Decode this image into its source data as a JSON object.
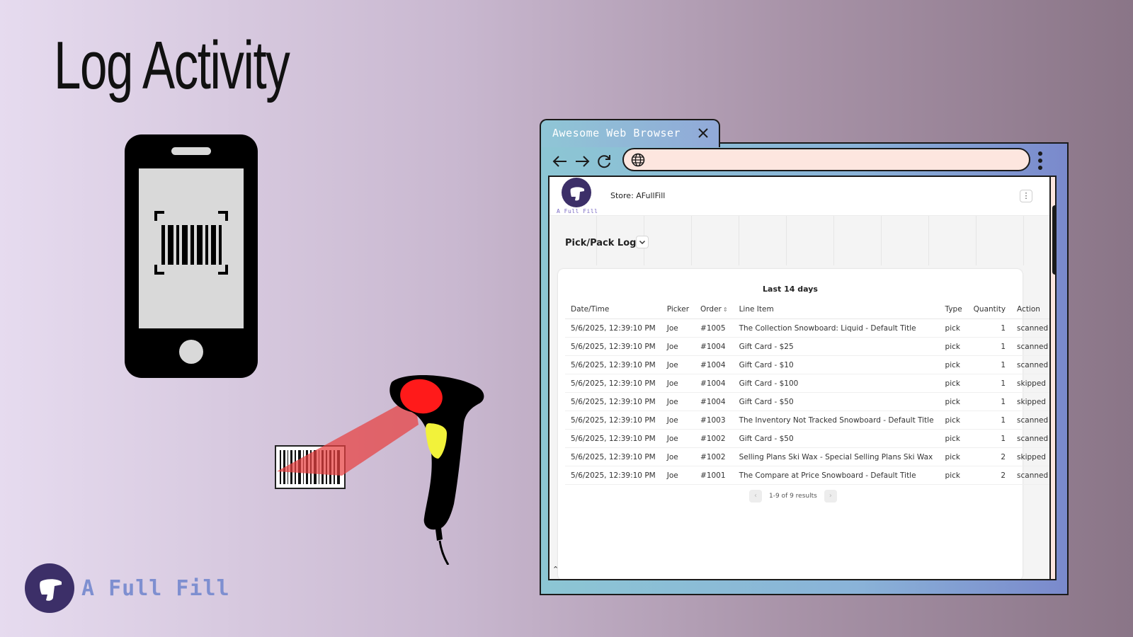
{
  "slide": {
    "headline": "Log Activity",
    "brand_name": "A Full Fill"
  },
  "browser": {
    "tab_title": "Awesome Web Browser",
    "url": ""
  },
  "app": {
    "logo_text": "A Full Fill",
    "store_label": "Store: AFullFill",
    "page_title": "Pick/Pack Logs",
    "card_title": "Last 14 days",
    "columns": [
      "Date/Time",
      "Picker",
      "Order",
      "Line Item",
      "Type",
      "Quantity",
      "Action"
    ],
    "rows": [
      {
        "datetime": "5/6/2025, 12:39:10 PM",
        "picker": "Joe",
        "order": "#1005",
        "line_item": "The Collection Snowboard: Liquid - Default Title",
        "type": "pick",
        "quantity": "1",
        "action": "scanned"
      },
      {
        "datetime": "5/6/2025, 12:39:10 PM",
        "picker": "Joe",
        "order": "#1004",
        "line_item": "Gift Card - $25",
        "type": "pick",
        "quantity": "1",
        "action": "scanned"
      },
      {
        "datetime": "5/6/2025, 12:39:10 PM",
        "picker": "Joe",
        "order": "#1004",
        "line_item": "Gift Card - $10",
        "type": "pick",
        "quantity": "1",
        "action": "scanned"
      },
      {
        "datetime": "5/6/2025, 12:39:10 PM",
        "picker": "Joe",
        "order": "#1004",
        "line_item": "Gift Card - $100",
        "type": "pick",
        "quantity": "1",
        "action": "skipped"
      },
      {
        "datetime": "5/6/2025, 12:39:10 PM",
        "picker": "Joe",
        "order": "#1004",
        "line_item": "Gift Card - $50",
        "type": "pick",
        "quantity": "1",
        "action": "skipped"
      },
      {
        "datetime": "5/6/2025, 12:39:10 PM",
        "picker": "Joe",
        "order": "#1003",
        "line_item": "The Inventory Not Tracked Snowboard - Default Title",
        "type": "pick",
        "quantity": "1",
        "action": "scanned"
      },
      {
        "datetime": "5/6/2025, 12:39:10 PM",
        "picker": "Joe",
        "order": "#1002",
        "line_item": "Gift Card - $50",
        "type": "pick",
        "quantity": "1",
        "action": "scanned"
      },
      {
        "datetime": "5/6/2025, 12:39:10 PM",
        "picker": "Joe",
        "order": "#1002",
        "line_item": "Selling Plans Ski Wax - Special Selling Plans Ski Wax",
        "type": "pick",
        "quantity": "2",
        "action": "skipped"
      },
      {
        "datetime": "5/6/2025, 12:39:10 PM",
        "picker": "Joe",
        "order": "#1001",
        "line_item": "The Compare at Price Snowboard - Default Title",
        "type": "pick",
        "quantity": "2",
        "action": "scanned"
      }
    ],
    "pagination": "1-9 of 9 results",
    "icons": {
      "sort": "sort-icon",
      "prev": "chevron-left-icon",
      "next": "chevron-right-icon",
      "dropdown": "chevron-down-icon",
      "menu": "kebab-icon"
    }
  },
  "colors": {
    "brand_purple": "#3c2f68",
    "brand_text": "#7e8fd0",
    "laser": "#e84040",
    "scanner_red": "#ff1a1a",
    "scanner_yellow": "#f2f23a"
  }
}
